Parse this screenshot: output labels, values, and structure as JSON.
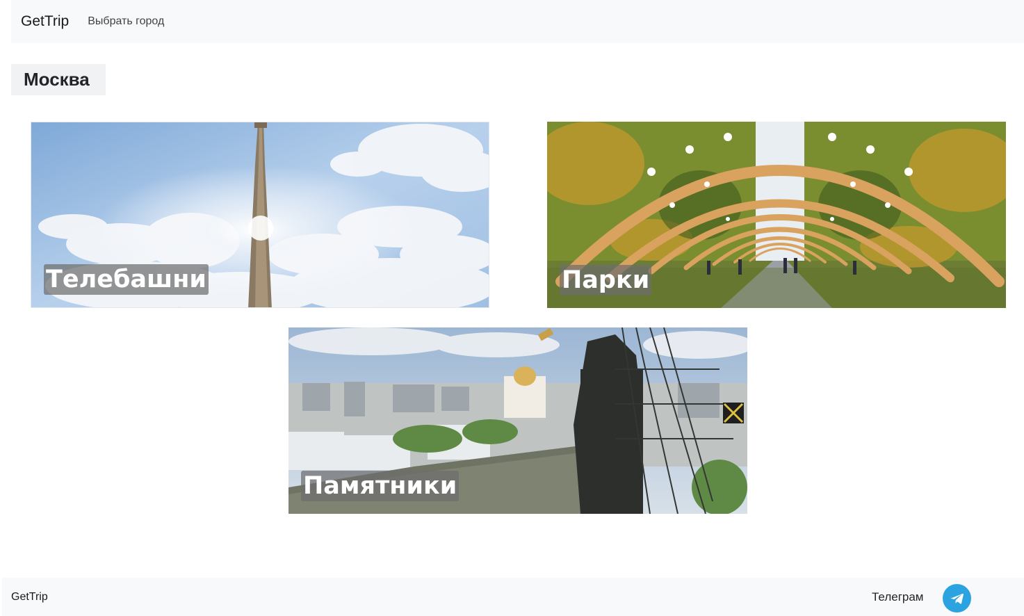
{
  "navbar": {
    "brand": "GetTrip",
    "city_select_label": "Выбрать город"
  },
  "city": {
    "name": "Москва"
  },
  "categories": [
    {
      "label": "Телебашни",
      "image": "tv-tower-photo"
    },
    {
      "label": "Парки",
      "image": "park-arches-photo"
    },
    {
      "label": "Памятники",
      "image": "monument-river-photo"
    }
  ],
  "footer": {
    "brand": "GetTrip",
    "telegram_label": "Телеграм",
    "telegram_icon": "telegram-icon"
  },
  "colors": {
    "navbar_bg": "#f8f9fa",
    "footer_bg": "#f8f9fa",
    "telegram_blue": "#2aa3e0"
  }
}
